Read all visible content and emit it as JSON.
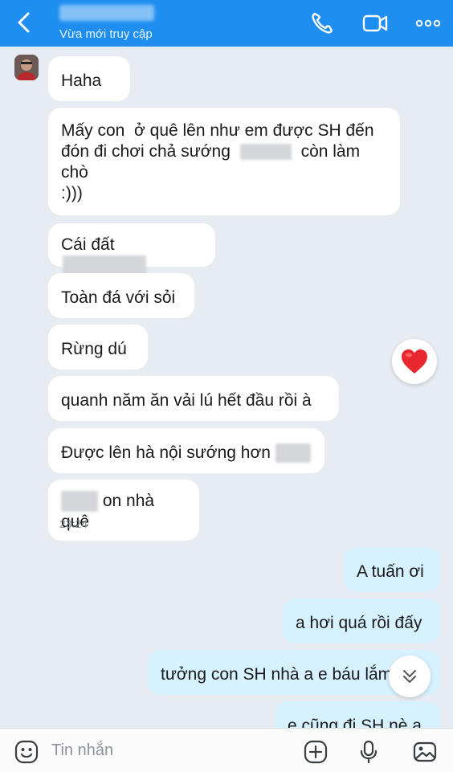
{
  "header": {
    "status": "Vừa mới truy cập"
  },
  "messages": {
    "m1": "Haha",
    "m2_l1": "Mấy con  ở quê lên như em được SH đến",
    "m2_l2a": "đón đi chơi chả sướng",
    "m2_l2b": "còn làm",
    "m2_l3": "chò",
    "m2_l4": ":)))",
    "m3": "Cái đất",
    "m4": "Toàn đá với sỏi",
    "m5": "Rừng dú",
    "m6": "quanh năm ăn vải lú hết đầu rồi à",
    "m7": "Được lên hà nội sướng hơn",
    "m8": "on nhà quê",
    "m8_time": "23:24",
    "r1": "A tuấn ơi",
    "r2": "a hơi quá rồi đấy",
    "r3": "tưởng con SH nhà a e báu lắm",
    "r4": "e cũng đi SH nè a"
  },
  "input": {
    "placeholder": "Tin nhắn"
  },
  "colors": {
    "header": "#1e8ef0",
    "background": "#e7ecf3",
    "sent_bubble": "#d6f1ff",
    "received_bubble": "#ffffff",
    "heart": "#e8282e"
  },
  "icons": {
    "back": "chevron-left-icon",
    "phone": "phone-icon",
    "video": "video-icon",
    "more": "more-icon",
    "heart": "heart-icon",
    "scroll": "chevrons-down-icon",
    "emoji": "emoji-icon",
    "add": "plus-icon",
    "mic": "mic-icon",
    "image": "image-icon"
  }
}
